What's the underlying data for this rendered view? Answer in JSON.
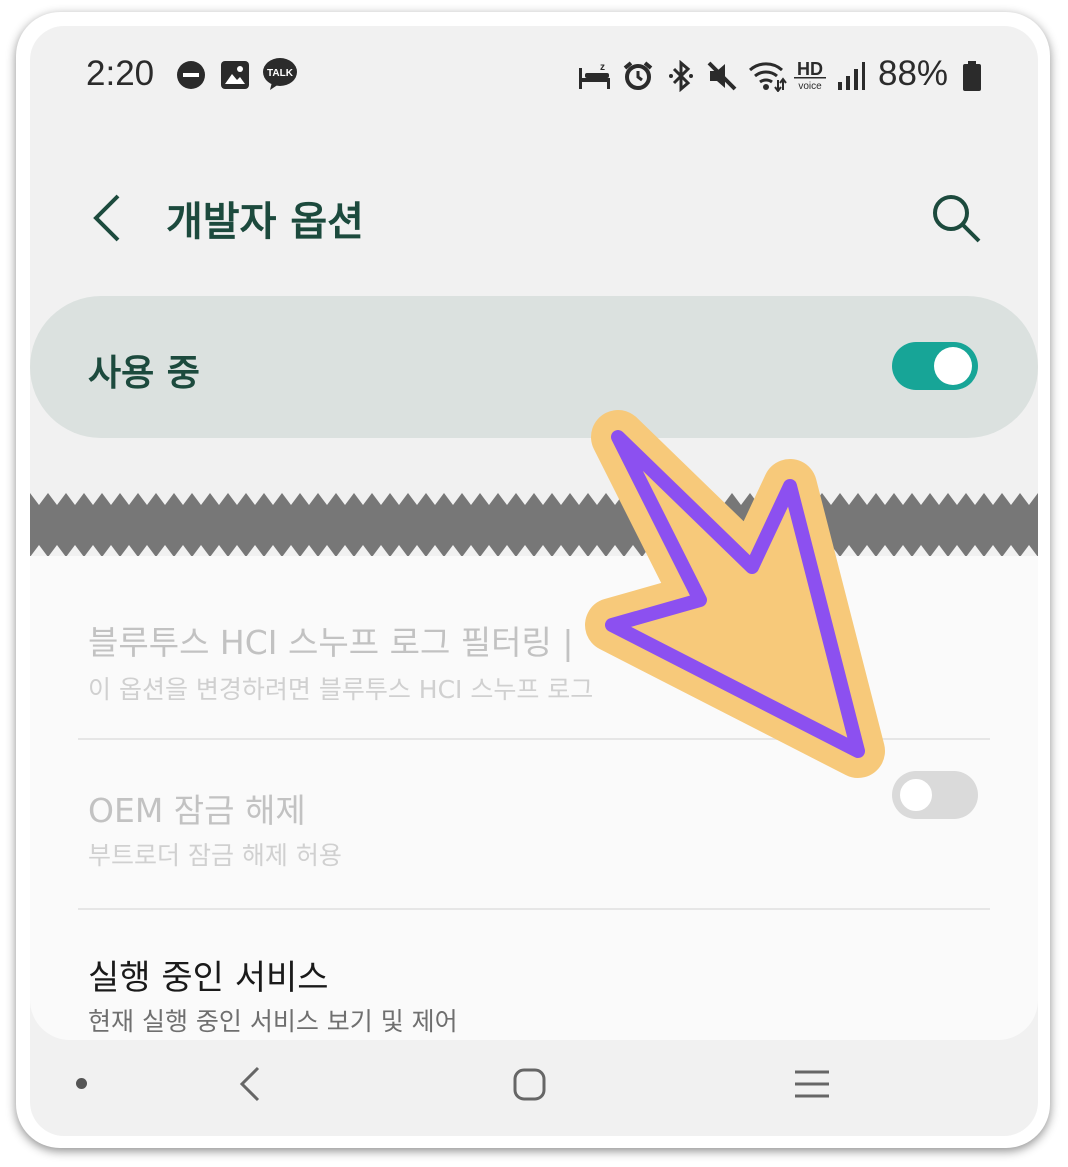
{
  "status_bar": {
    "time": "2:20",
    "battery": "88%",
    "hd_label": "HD",
    "voice_label": "voice",
    "talk_label": "TALK",
    "left_icons": [
      "do-not-disturb-icon",
      "gallery-icon",
      "kakaotalk-icon"
    ],
    "right_icons": [
      "sleep-mode-icon",
      "alarm-icon",
      "bluetooth-icon",
      "mute-icon",
      "wifi-icon",
      "hd-voice-icon",
      "signal-icon",
      "battery-icon"
    ]
  },
  "header": {
    "title": "개발자 옵션"
  },
  "master_toggle": {
    "label": "사용 중",
    "state": "on",
    "color": "#17a597"
  },
  "settings": [
    {
      "title": "블루투스 HCI 스누프 로그 필터링 |",
      "subtitle": "이 옵션을 변경하려면 블루투스 HCI 스누프 로그",
      "enabled": false
    },
    {
      "title": "OEM 잠금 해제",
      "subtitle": "부트로더 잠금 해제 허용",
      "enabled": false,
      "toggle": "off"
    },
    {
      "title": "실행 중인 서비스",
      "subtitle": "현재 실행 중인 서비스 보기 및 제어",
      "enabled": true
    }
  ],
  "annotation": {
    "type": "arrow",
    "fill": "#f7c97a",
    "outline": "#8c50f0",
    "points_to": "OEM 잠금 해제 toggle"
  },
  "nav_bar": {
    "buttons": [
      "back",
      "home",
      "recents"
    ]
  }
}
